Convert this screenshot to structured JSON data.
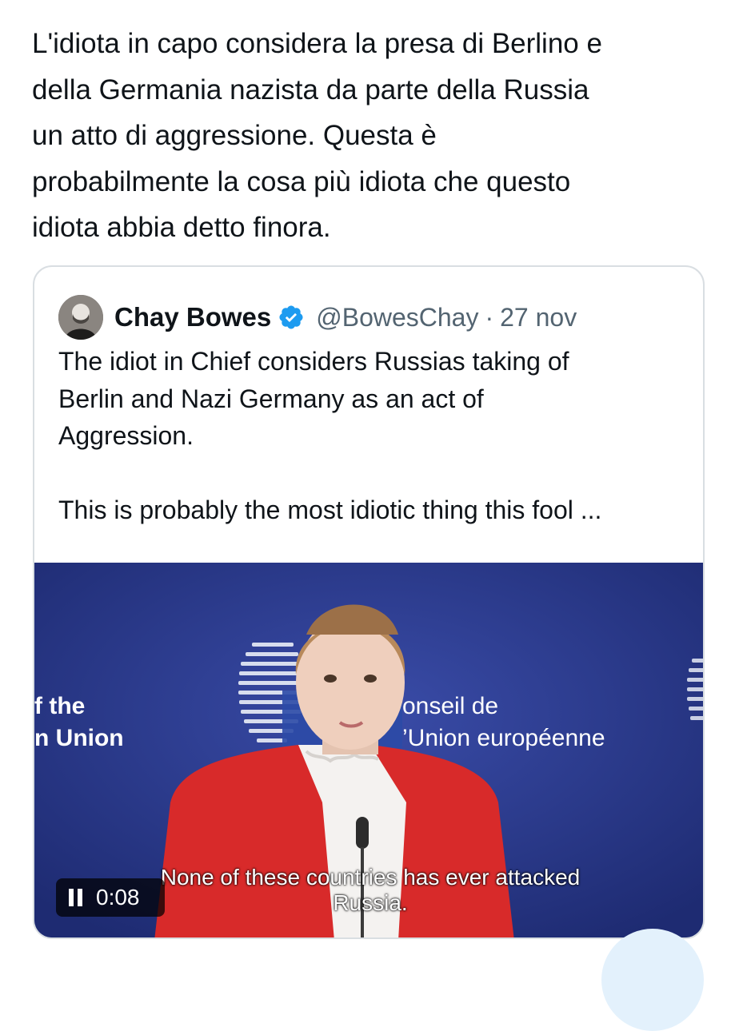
{
  "tweet": {
    "text": "L'idiota in capo considera la presa di Berlino e\ndella Germania nazista da parte della Russia\nun atto di aggressione.  Questa è\nprobabilmente la cosa più idiota che questo\nidiota abbia detto finora."
  },
  "quote": {
    "author_name": "Chay Bowes",
    "handle": "@BowesChay",
    "separator": "·",
    "date": "27 nov",
    "text": "The idiot in Chief considers Russias taking of\nBerlin and Nazi Germany as an act of\nAggression.\n\nThis is probably the most idiotic thing this fool ...",
    "media": {
      "background_left_line1": "f the",
      "background_left_line2": "n Union",
      "background_right_line1": "onseil de",
      "background_right_line2": "’Union européenne",
      "subtitle_line1": "None of these countries has ever attacked",
      "subtitle_line2": "Russia.",
      "elapsed_time": "0:08",
      "icon_state": "pause-icon"
    }
  },
  "colors": {
    "text": "#0f1419",
    "secondary": "#536471",
    "border": "#d9dee2",
    "verified": "#1d9bf0",
    "video_bg": "#2a3a8c",
    "jacket": "#d82a2a"
  }
}
